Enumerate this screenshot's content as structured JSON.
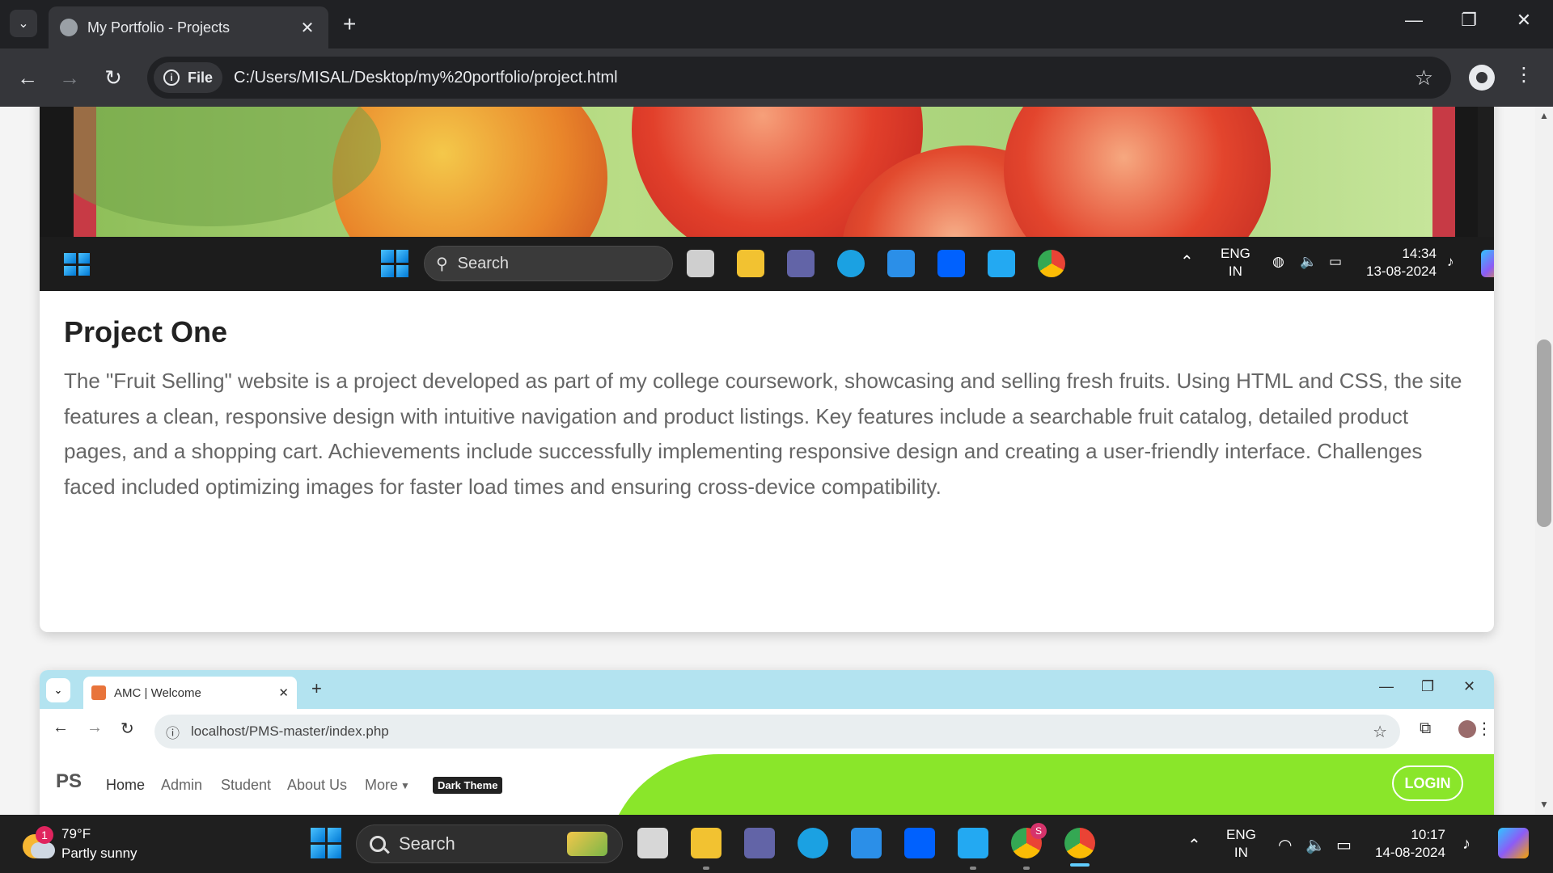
{
  "browser": {
    "tab_title": "My Portfolio - Projects",
    "url_chip": "File",
    "url": "C:/Users/MISAL/Desktop/my%20portfolio/project.html"
  },
  "project_one": {
    "title": "Project One",
    "description": "The \"Fruit Selling\" website is a project developed as part of my college coursework, showcasing and selling fresh fruits. Using HTML and CSS, the site features a clean, responsive design with intuitive navigation and product listings. Key features include a searchable fruit catalog, detailed product pages, and a shopping cart. Achievements include successfully implementing responsive design and creating a user-friendly interface. Challenges faced included optimizing images for faster load times and ensuring cross-device compatibility.",
    "screenshot_taskbar": {
      "search": "Search",
      "lang": "ENG",
      "region": "IN",
      "time": "14:34",
      "date": "13-08-2024"
    }
  },
  "project_two": {
    "screenshot": {
      "tab_title": "AMC | Welcome",
      "url": "localhost/PMS-master/index.php",
      "logo": "PS",
      "nav": [
        "Home",
        "Admin",
        "Student",
        "About Us",
        "More"
      ],
      "theme_button": "Dark Theme",
      "login": "LOGIN"
    }
  },
  "taskbar": {
    "weather_badge": "1",
    "temperature": "79°F",
    "condition": "Partly sunny",
    "search": "Search",
    "lang": "ENG",
    "region": "IN",
    "time": "10:17",
    "date": "14-08-2024",
    "chrome_badge": "S"
  },
  "colors": {
    "chrome_dark": "#202124",
    "toolbar": "#35363a",
    "accent_blue": "#60cdff",
    "green": "#8ae62a",
    "red_border": "#c73a45"
  }
}
